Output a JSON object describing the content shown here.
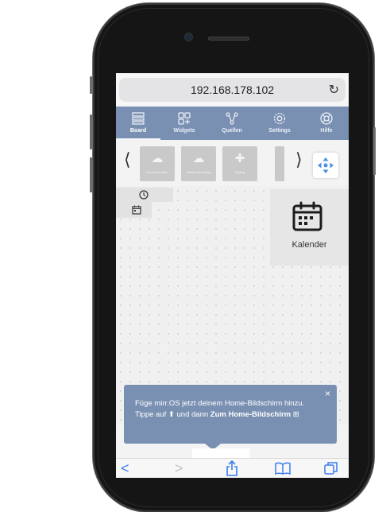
{
  "browser": {
    "url": "192.168.178.102",
    "reload_icon": "reload-icon"
  },
  "nav": {
    "items": [
      {
        "label": "Board",
        "icon": "board-icon",
        "active": true
      },
      {
        "label": "Widgets",
        "icon": "widgets-icon",
        "active": false
      },
      {
        "label": "Quellen",
        "icon": "sources-icon",
        "active": false
      },
      {
        "label": "Settings",
        "icon": "settings-icon",
        "active": false
      },
      {
        "label": "Hilfe",
        "icon": "help-icon",
        "active": false
      }
    ],
    "color": "#7a90b2"
  },
  "widget_picker": {
    "prev": "⟨",
    "next": "⟩",
    "tiles": [
      {
        "label": "Currentweather",
        "icon": "weather-icon"
      },
      {
        "label": "Wettervorhersage",
        "icon": "forecast-icon"
      },
      {
        "label": "Styling",
        "icon": "styling-icon"
      },
      {
        "label": "",
        "icon": ""
      }
    ],
    "move_icon": "move-arrows-icon"
  },
  "board": {
    "placed_widgets": [
      "clock",
      "calendar"
    ]
  },
  "side_panel": {
    "label": "Kalender",
    "icon": "calendar-icon"
  },
  "banner": {
    "text_part1": "Füge mirr.OS jetzt deinem Home-Bildschirm hinzu. Tippe auf",
    "text_part2": "und dann",
    "text_bold": "Zum Home-Bildschirm",
    "close": "×"
  },
  "safari_toolbar": {
    "back": "<",
    "forward": ">",
    "share_icon": "share-icon",
    "bookmarks_icon": "bookmarks-icon",
    "tabs_icon": "tabs-icon"
  }
}
